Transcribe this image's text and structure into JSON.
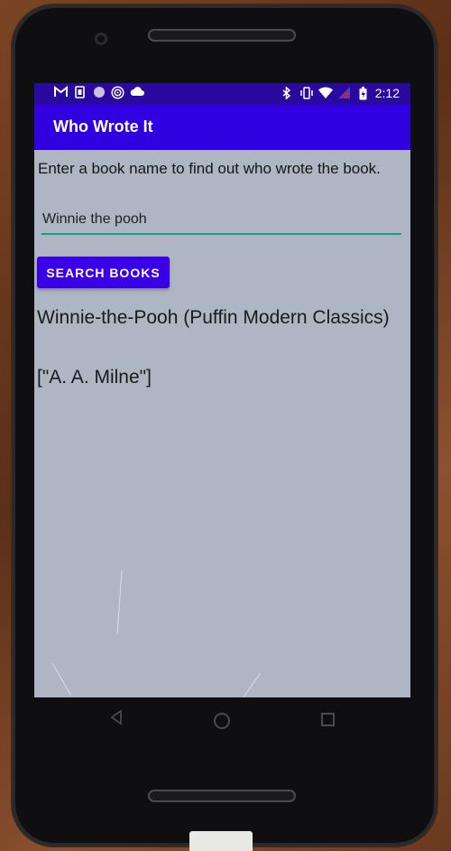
{
  "status_bar": {
    "time": "2:12",
    "left_icons": [
      "gmail-icon",
      "sim-icon",
      "circle-icon",
      "radio-icon",
      "cloud-icon"
    ],
    "right_icons": [
      "bluetooth-icon",
      "vibrate-icon",
      "wifi-icon",
      "no-signal-icon",
      "battery-icon"
    ]
  },
  "app_bar": {
    "title": "Who Wrote It"
  },
  "main": {
    "instructions": "Enter a book name to find out who wrote the book.",
    "book_input": {
      "value": "Winnie the pooh"
    },
    "search_button_label": "SEARCH BOOKS",
    "result_title": "Winnie-the-Pooh (Puffin Modern Classics)",
    "result_author": "[\"A. A. Milne\"]"
  },
  "navigation": {
    "icons": [
      "back-icon",
      "home-icon",
      "recents-icon"
    ]
  },
  "colors": {
    "status_bar": "#2a0a9e",
    "app_bar": "#3100e0",
    "button": "#3a00e8",
    "input_underline": "#179f85",
    "screen_background": "#aeb6c3"
  }
}
